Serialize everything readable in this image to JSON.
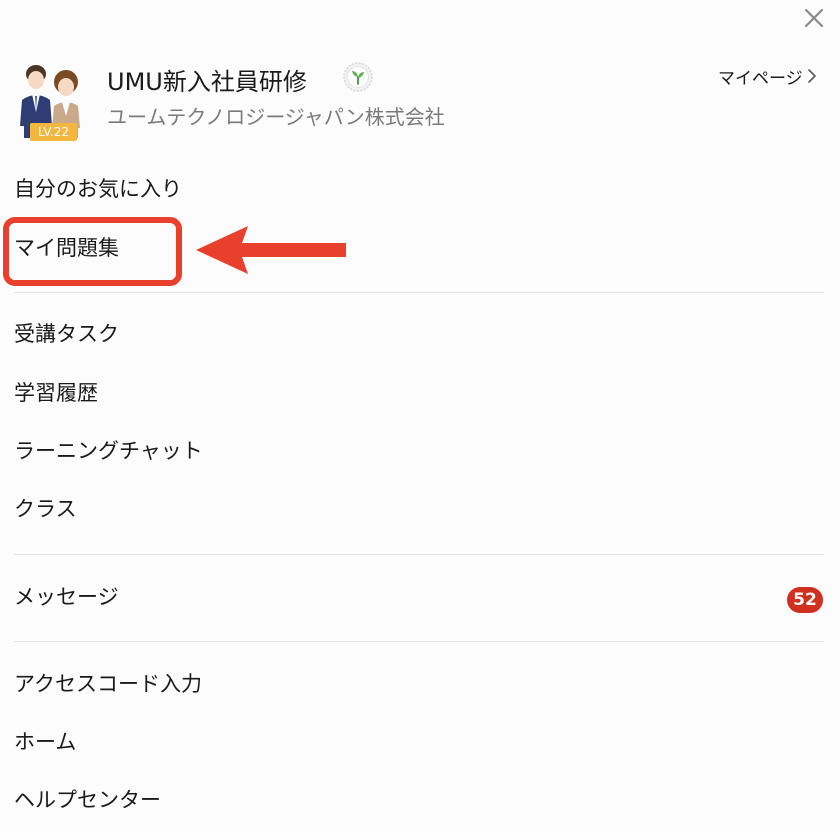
{
  "header": {
    "course_title": "UMU新入社員研修",
    "company_name": "ユームテクノロジージャパン株式会社",
    "level": "LV.22",
    "mypage_label": "マイページ"
  },
  "menu": {
    "group1": [
      {
        "label": "自分のお気に入り"
      },
      {
        "label": "マイ問題集"
      }
    ],
    "group2": [
      {
        "label": "受講タスク"
      },
      {
        "label": "学習履歴"
      },
      {
        "label": "ラーニングチャット"
      },
      {
        "label": "クラス"
      }
    ],
    "group3": [
      {
        "label": "メッセージ",
        "badge": "52"
      }
    ],
    "group4": [
      {
        "label": "アクセスコード入力"
      },
      {
        "label": "ホーム"
      },
      {
        "label": "ヘルプセンター"
      }
    ]
  },
  "colors": {
    "accent_red": "#e8402c",
    "badge_red": "#d0311f",
    "level_gold": "#f3b63e"
  },
  "icons": [
    "close-icon",
    "leaf-emblem-icon",
    "chevron-right-icon",
    "avatar",
    "arrow-annotation"
  ]
}
